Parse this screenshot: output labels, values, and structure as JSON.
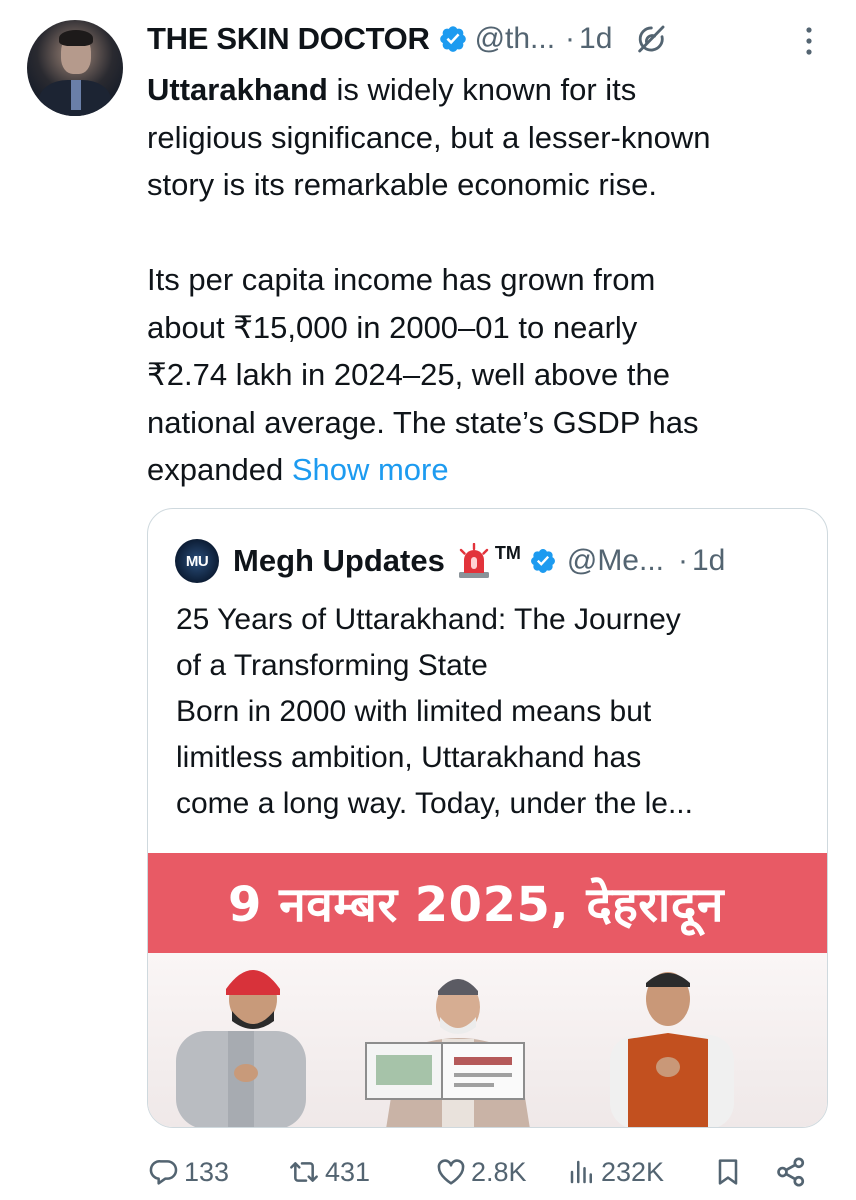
{
  "tweet": {
    "author_name": "THE SKIN DOCTOR",
    "handle": "@th...",
    "time": "1d",
    "text": {
      "para1_bold": "Uttarakhand",
      "para1_line1_rest": " is widely known for its",
      "para1_line2": "religious significance, but a lesser-known",
      "para1_line3": "story is its remarkable economic rise.",
      "para2_line1": "Its per capita income has grown from",
      "para2_line2": "about ₹15,000 in 2000–01 to nearly",
      "para2_line3": "₹2.74 lakh in 2024–25, well above the",
      "para2_line4": "national average. The state’s GSDP has",
      "para2_line5": "expanded "
    },
    "show_more": "Show more"
  },
  "quote": {
    "avatar_text": "MU",
    "author_name": "Megh Updates",
    "tm": "TM",
    "handle": "@Me...",
    "time": "1d",
    "lines": [
      "25 Years of Uttarakhand: The Journey",
      "of a Transforming State",
      "Born in 2000 with limited means but",
      "limitless ambition, Uttarakhand has",
      "come a long way. Today, under the le..."
    ],
    "image_banner": "9 नवम्बर 2025, देहरादून"
  },
  "actions": {
    "replies": "133",
    "reposts": "431",
    "likes": "2.8K",
    "views": "232K"
  },
  "colors": {
    "link": "#1d9bf0",
    "secondary_text": "#536471",
    "verified": "#1d9bf0",
    "banner": "#e85a65"
  },
  "icons": [
    "verified-badge-icon",
    "grok-icon",
    "more-options-icon",
    "siren-emoji-icon",
    "reply-icon",
    "repost-icon",
    "like-icon",
    "views-icon",
    "bookmark-icon",
    "share-icon"
  ]
}
